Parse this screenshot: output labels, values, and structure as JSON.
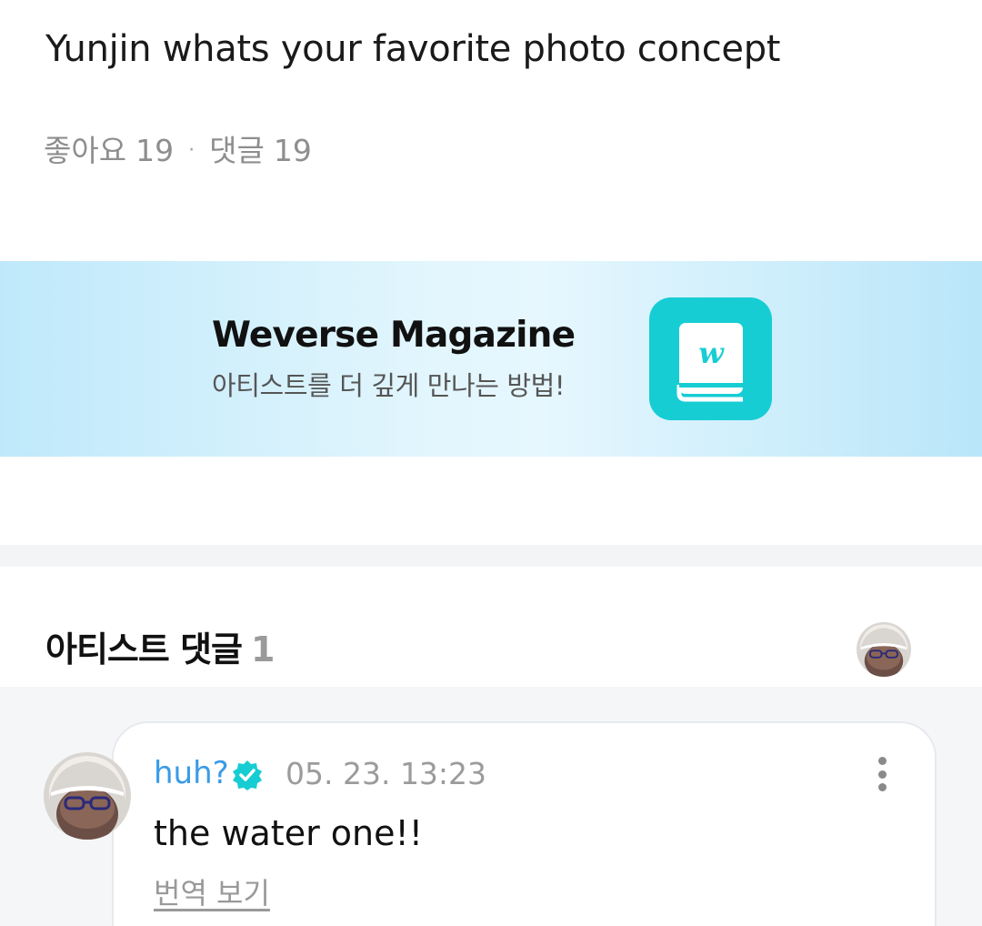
{
  "post": {
    "title": "Yunjin whats your favorite photo concept",
    "likes_label": "좋아요",
    "likes_count": "19",
    "separator": "·",
    "comments_label": "댓글",
    "comments_count": "19"
  },
  "banner": {
    "title": "Weverse Magazine",
    "subtitle": "아티스트를 더 깊게 만나는 방법!",
    "icon": "weverse-magazine-book-icon",
    "icon_letter": "w",
    "accent_color": "#17cdd4"
  },
  "artist_comments": {
    "header_label": "아티스트 댓글",
    "count": "1",
    "avatar_icon": "artist-avatar",
    "items": [
      {
        "author": "huh?",
        "verified_icon": "verified-badge-icon",
        "timestamp": "05. 23. 13:23",
        "text": "the water one!!",
        "translate_label": "번역 보기",
        "more_icon": "more-vertical-icon"
      }
    ]
  },
  "colors": {
    "author": "#3a9be6",
    "verified": "#17cdd4",
    "muted_text": "#8e8e8e",
    "section_background": "#f5f6f8"
  }
}
